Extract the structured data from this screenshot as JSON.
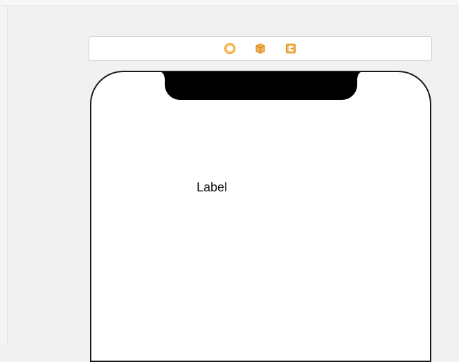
{
  "scene_dock": {
    "icons": [
      {
        "name": "view-controller-icon",
        "color": "#f2a33a"
      },
      {
        "name": "first-responder-icon",
        "color": "#f0a23c"
      },
      {
        "name": "exit-icon",
        "color": "#f0a23c"
      }
    ]
  },
  "device": {
    "label_text": "Label"
  },
  "colors": {
    "accent": "#f2a33a",
    "canvas_bg": "#f1f1f1",
    "device_bg": "#ffffff",
    "device_frame": "#1a1a1a"
  }
}
